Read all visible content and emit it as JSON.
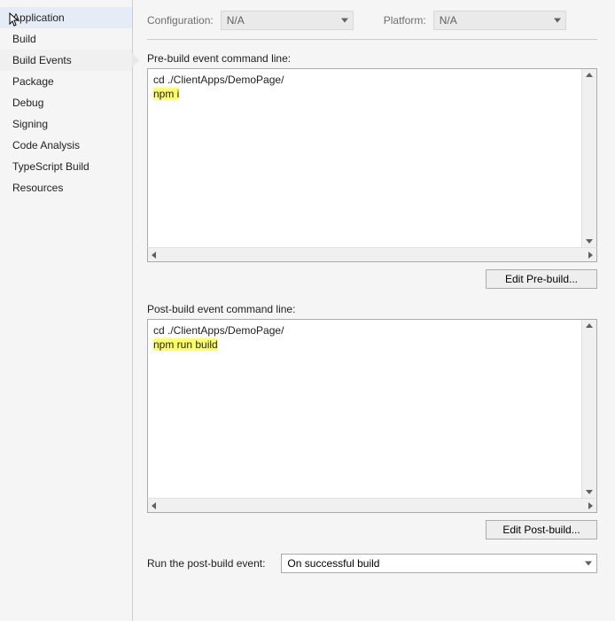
{
  "sidebar": {
    "items": [
      {
        "label": "Application"
      },
      {
        "label": "Build"
      },
      {
        "label": "Build Events"
      },
      {
        "label": "Package"
      },
      {
        "label": "Debug"
      },
      {
        "label": "Signing"
      },
      {
        "label": "Code Analysis"
      },
      {
        "label": "TypeScript Build"
      },
      {
        "label": "Resources"
      }
    ]
  },
  "config": {
    "configuration_label": "Configuration:",
    "configuration_value": "N/A",
    "platform_label": "Platform:",
    "platform_value": "N/A"
  },
  "prebuild": {
    "label": "Pre-build event command line:",
    "line1": "cd ./ClientApps/DemoPage/",
    "line2": "npm i",
    "button": "Edit Pre-build..."
  },
  "postbuild": {
    "label": "Post-build event command line:",
    "line1": "cd ./ClientApps/DemoPage/",
    "line2": "npm run build",
    "button": "Edit Post-build..."
  },
  "runpost": {
    "label": "Run the post-build event:",
    "value": "On successful build"
  }
}
